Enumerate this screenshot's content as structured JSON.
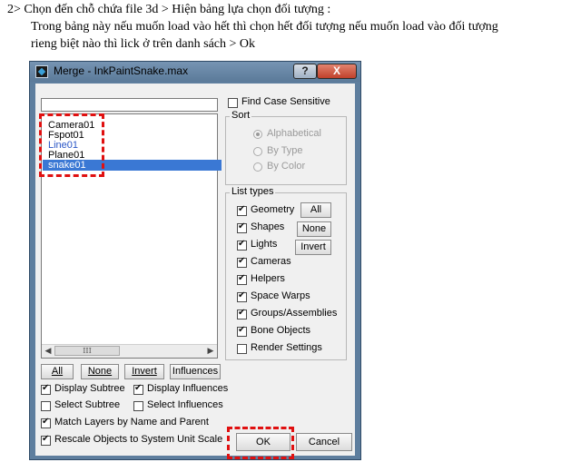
{
  "doc": {
    "line1": "2>  Chọn đến chỗ chứa file 3d > Hiện bảng lựa chọn đối tượng :",
    "line2": "Trong bảng này nếu muốn load vào hết thì chọn hết đối tượng nếu muốn load vào đối tượng",
    "line3": "rieng biệt nào thì lick ở trên danh sách > Ok"
  },
  "window": {
    "title": "Merge - InkPaintSnake.max",
    "help_label": "?",
    "close_label": "X"
  },
  "objects": [
    {
      "name": "Camera01",
      "color": "#000000",
      "selected": false
    },
    {
      "name": "Fspot01",
      "color": "#000000",
      "selected": false
    },
    {
      "name": "Line01",
      "color": "#2a56c6",
      "selected": false
    },
    {
      "name": "Plane01",
      "color": "#000000",
      "selected": false
    },
    {
      "name": "snake01",
      "color": "#ffffff",
      "selected": true
    }
  ],
  "scroll_grip": "III",
  "find_case": {
    "label": "Find Case Sensitive",
    "checked": false
  },
  "sort": {
    "title": "Sort",
    "options": [
      {
        "label": "Alphabetical",
        "checked": true
      },
      {
        "label": "By Type",
        "checked": false
      },
      {
        "label": "By Color",
        "checked": false
      }
    ]
  },
  "list_types": {
    "title": "List types",
    "items": [
      {
        "label": "Geometry",
        "checked": true
      },
      {
        "label": "Shapes",
        "checked": true
      },
      {
        "label": "Lights",
        "checked": true
      },
      {
        "label": "Cameras",
        "checked": true
      },
      {
        "label": "Helpers",
        "checked": true
      },
      {
        "label": "Space Warps",
        "checked": true
      },
      {
        "label": "Groups/Assemblies",
        "checked": true
      },
      {
        "label": "Bone Objects",
        "checked": true
      },
      {
        "label": "Render Settings",
        "checked": false
      }
    ],
    "buttons": {
      "all": "All",
      "none": "None",
      "invert": "Invert"
    }
  },
  "select_buttons": {
    "all": "All",
    "none": "None",
    "invert": "Invert",
    "influences": "Influences"
  },
  "options": {
    "display_subtree": {
      "label": "Display Subtree",
      "checked": true
    },
    "display_influences": {
      "label": "Display Influences",
      "checked": true
    },
    "select_subtree": {
      "label": "Select Subtree",
      "checked": false
    },
    "select_influences": {
      "label": "Select Influences",
      "checked": false
    },
    "match_layers": {
      "label": "Match Layers by Name and Parent",
      "checked": true
    },
    "rescale": {
      "label": "Rescale Objects to System Unit Scale",
      "checked": true
    }
  },
  "ok_label": "OK",
  "cancel_label": "Cancel",
  "highlight_color": "#e01010"
}
